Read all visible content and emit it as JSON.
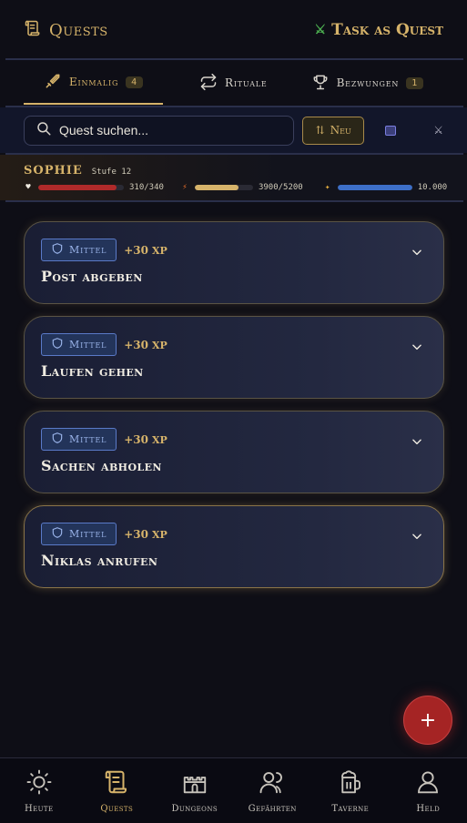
{
  "header": {
    "app_title": "Quests",
    "app_icon": "scroll-icon",
    "task_as_quest_label": "Task as Quest",
    "task_as_quest_icon": "crossed-swords-icon"
  },
  "tabs": [
    {
      "label": "Einmalig",
      "badge": "4",
      "icon": "sword-icon",
      "active": true
    },
    {
      "label": "Rituale",
      "icon": "repeat-icon",
      "active": false
    },
    {
      "label": "Bezwungen",
      "badge": "1",
      "icon": "trophy-icon",
      "active": false
    }
  ],
  "search": {
    "placeholder": "Quest suchen...",
    "sort_label": "Neu"
  },
  "hero": {
    "name": "SOPHIE",
    "level": "Stufe 12",
    "hp_text": "310/340",
    "hp_fraction": 0.91,
    "energy_text": "3900/5200",
    "energy_fraction": 0.75,
    "xp_text": "10.000",
    "xp_fraction": 1.0,
    "colors": {
      "hp": "#b02a2a",
      "energy": "#d6b36a",
      "xp": "#3d6fc8"
    }
  },
  "quests": [
    {
      "difficulty": "Mittel",
      "xp": "+30",
      "xp_unit": "XP",
      "title": "Post abgeben"
    },
    {
      "difficulty": "Mittel",
      "xp": "+30",
      "xp_unit": "XP",
      "title": "Laufen gehen"
    },
    {
      "difficulty": "Mittel",
      "xp": "+30",
      "xp_unit": "XP",
      "title": "Sachen abholen"
    },
    {
      "difficulty": "Mittel",
      "xp": "+30",
      "xp_unit": "XP",
      "title": "Niklas anrufen"
    }
  ],
  "fab_label": "+",
  "nav": [
    {
      "label": "Heute",
      "icon": "sun-icon",
      "active": false
    },
    {
      "label": "Quests",
      "icon": "scroll-icon",
      "active": true
    },
    {
      "label": "Dungeons",
      "icon": "castle-icon",
      "active": false
    },
    {
      "label": "Gefährten",
      "icon": "users-icon",
      "active": false
    },
    {
      "label": "Taverne",
      "icon": "beer-mug-icon",
      "active": false
    },
    {
      "label": "Held",
      "icon": "user-icon",
      "active": false
    }
  ],
  "colors": {
    "accent": "#d6b36a",
    "background": "#0e0e16",
    "fab": "#a52424"
  }
}
